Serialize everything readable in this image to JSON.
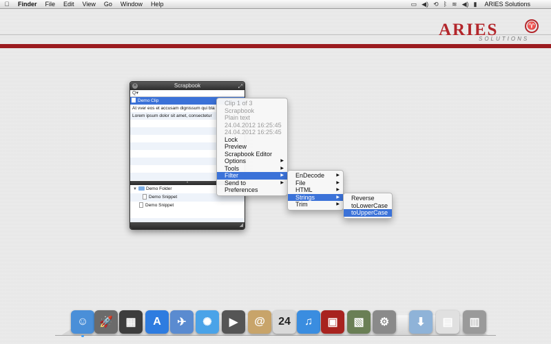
{
  "menubar": {
    "apple": "",
    "items": [
      "Finder",
      "File",
      "Edit",
      "View",
      "Go",
      "Window",
      "Help"
    ],
    "status_icons": [
      "display-icon",
      "volume-icon",
      "time-machine-icon",
      "bluetooth-icon",
      "wifi-icon",
      "volume-icon",
      "battery-icon"
    ],
    "user": "ARIES Solutions"
  },
  "logo": {
    "word": "ARIES",
    "sub": "SOLUTIONS"
  },
  "scrapbook": {
    "title": "Scrapbook",
    "search_placeholder": "Q▾",
    "clips": [
      "Demo Clip",
      "At vver eos et accusam dignissum qui bla",
      "Lorem ipsum dolor sit amet, consectetur"
    ],
    "tree": [
      {
        "label": "Demo Folder",
        "kind": "folder"
      },
      {
        "label": "Demo Snippet",
        "kind": "doc"
      },
      {
        "label": "Demo Snippet",
        "kind": "doc"
      }
    ]
  },
  "context_menu": {
    "items": [
      {
        "label": "Clip 1 of 3",
        "disabled": true
      },
      {
        "label": "Scrapbook",
        "disabled": true
      },
      {
        "label": "Plain text",
        "disabled": true
      },
      {
        "label": "24.04.2012 16:25:45",
        "disabled": true
      },
      {
        "label": "24.04.2012 16:25:45",
        "disabled": true
      },
      {
        "label": "Lock"
      },
      {
        "label": "Preview"
      },
      {
        "label": "Scrapbook Editor"
      },
      {
        "label": "Options",
        "submenu": true
      },
      {
        "label": "Tools",
        "submenu": true
      },
      {
        "label": "Filter",
        "submenu": true,
        "highlighted": true
      },
      {
        "label": "Send to",
        "submenu": true
      },
      {
        "label": "Preferences"
      }
    ]
  },
  "filter_menu": {
    "items": [
      {
        "label": "EnDecode",
        "submenu": true
      },
      {
        "label": "File",
        "submenu": true
      },
      {
        "label": "HTML",
        "submenu": true
      },
      {
        "label": "Strings",
        "submenu": true,
        "highlighted": true
      },
      {
        "label": "Trim",
        "submenu": true
      }
    ]
  },
  "strings_menu": {
    "items": [
      {
        "label": "Reverse"
      },
      {
        "label": "toLowerCase"
      },
      {
        "label": "toUpperCase",
        "highlighted": true
      }
    ]
  },
  "dock": {
    "apps": [
      {
        "name": "finder",
        "glyph": "☺",
        "color": "#4a8fd8",
        "running": true
      },
      {
        "name": "launchpad",
        "glyph": "🚀",
        "color": "#6b6b6b",
        "running": false
      },
      {
        "name": "mission-control",
        "glyph": "▦",
        "color": "#3d3d3d",
        "running": false
      },
      {
        "name": "app-store",
        "glyph": "A",
        "color": "#2e7ce0",
        "running": false
      },
      {
        "name": "preview",
        "glyph": "✈",
        "color": "#5a8bd0",
        "running": false
      },
      {
        "name": "safari",
        "glyph": "✺",
        "color": "#4aa3e8",
        "running": false
      },
      {
        "name": "facetime",
        "glyph": "▶",
        "color": "#555555",
        "running": false
      },
      {
        "name": "address-book",
        "glyph": "@",
        "color": "#c8a46a",
        "running": false
      },
      {
        "name": "ical",
        "glyph": "24",
        "color": "#d9d9d9",
        "running": false
      },
      {
        "name": "itunes",
        "glyph": "♫",
        "color": "#3a8de0",
        "running": false
      },
      {
        "name": "photo-booth",
        "glyph": "▣",
        "color": "#a8231f",
        "running": false
      },
      {
        "name": "iphoto",
        "glyph": "▧",
        "color": "#6a7f55",
        "running": false
      },
      {
        "name": "system-preferences",
        "glyph": "⚙",
        "color": "#8a8a8a",
        "running": false
      },
      {
        "name": "downloads-folder",
        "glyph": "⬇",
        "color": "#8fb3d8",
        "running": false
      },
      {
        "name": "documents-stack",
        "glyph": "▤",
        "color": "#e0e0e0",
        "running": false
      },
      {
        "name": "trash",
        "glyph": "▥",
        "color": "#9a9a9a",
        "running": false
      }
    ]
  }
}
